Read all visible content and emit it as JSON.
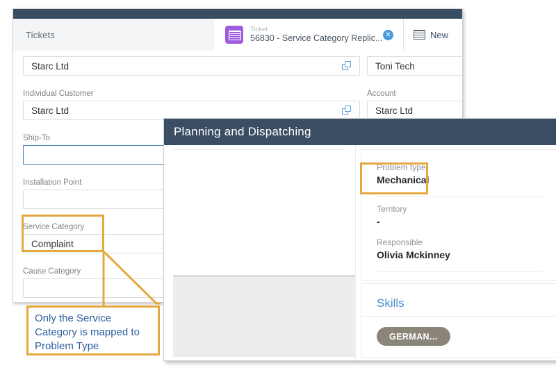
{
  "ticket_window": {
    "tabs": {
      "tickets_label": "Tickets",
      "active_kind": "Ticket",
      "active_title": "56830 - Service Category Replic...",
      "close_glyph": "✕",
      "new_label": "New"
    },
    "fields": [
      {
        "label": "",
        "value": "Starc Ltd",
        "has_link_icon": true,
        "focused": false
      },
      {
        "label": "",
        "value": "Toni Tech",
        "has_link_icon": false,
        "focused": false
      },
      {
        "label": "Individual Customer",
        "value": "Starc Ltd",
        "has_link_icon": true,
        "focused": false
      },
      {
        "label": "Account",
        "value": "Starc Ltd",
        "has_link_icon": false,
        "focused": false
      },
      {
        "label": "Ship-To",
        "value": "",
        "has_link_icon": false,
        "focused": true
      },
      {
        "label": "Installation Point",
        "value": "",
        "has_link_icon": false,
        "focused": false
      },
      {
        "label": "Service Category",
        "value": "Complaint",
        "has_link_icon": false,
        "focused": false
      },
      {
        "label": "Cause Category",
        "value": "",
        "has_link_icon": false,
        "focused": false
      }
    ]
  },
  "planning_window": {
    "title": "Planning and Dispatching",
    "details": [
      {
        "label": "Problem type",
        "value": "Mechanical"
      },
      {
        "label": "Territory",
        "value": "-"
      },
      {
        "label": "Responsible",
        "value": "Olivia Mckinney"
      }
    ],
    "skills": {
      "title": "Skills",
      "tags": [
        "GERMAN..."
      ]
    }
  },
  "annotation": {
    "text": "Only the Service Category is mapped to Problem Type",
    "highlight_color": "#e5a83c",
    "text_color": "#2b5e9e"
  },
  "colors": {
    "header_navy": "#3b4d63",
    "tab_purple": "#a05ce0",
    "focus_blue": "#4a7ebb",
    "skill_tag": "#8a8479",
    "link_blue": "#4a8bd0"
  }
}
